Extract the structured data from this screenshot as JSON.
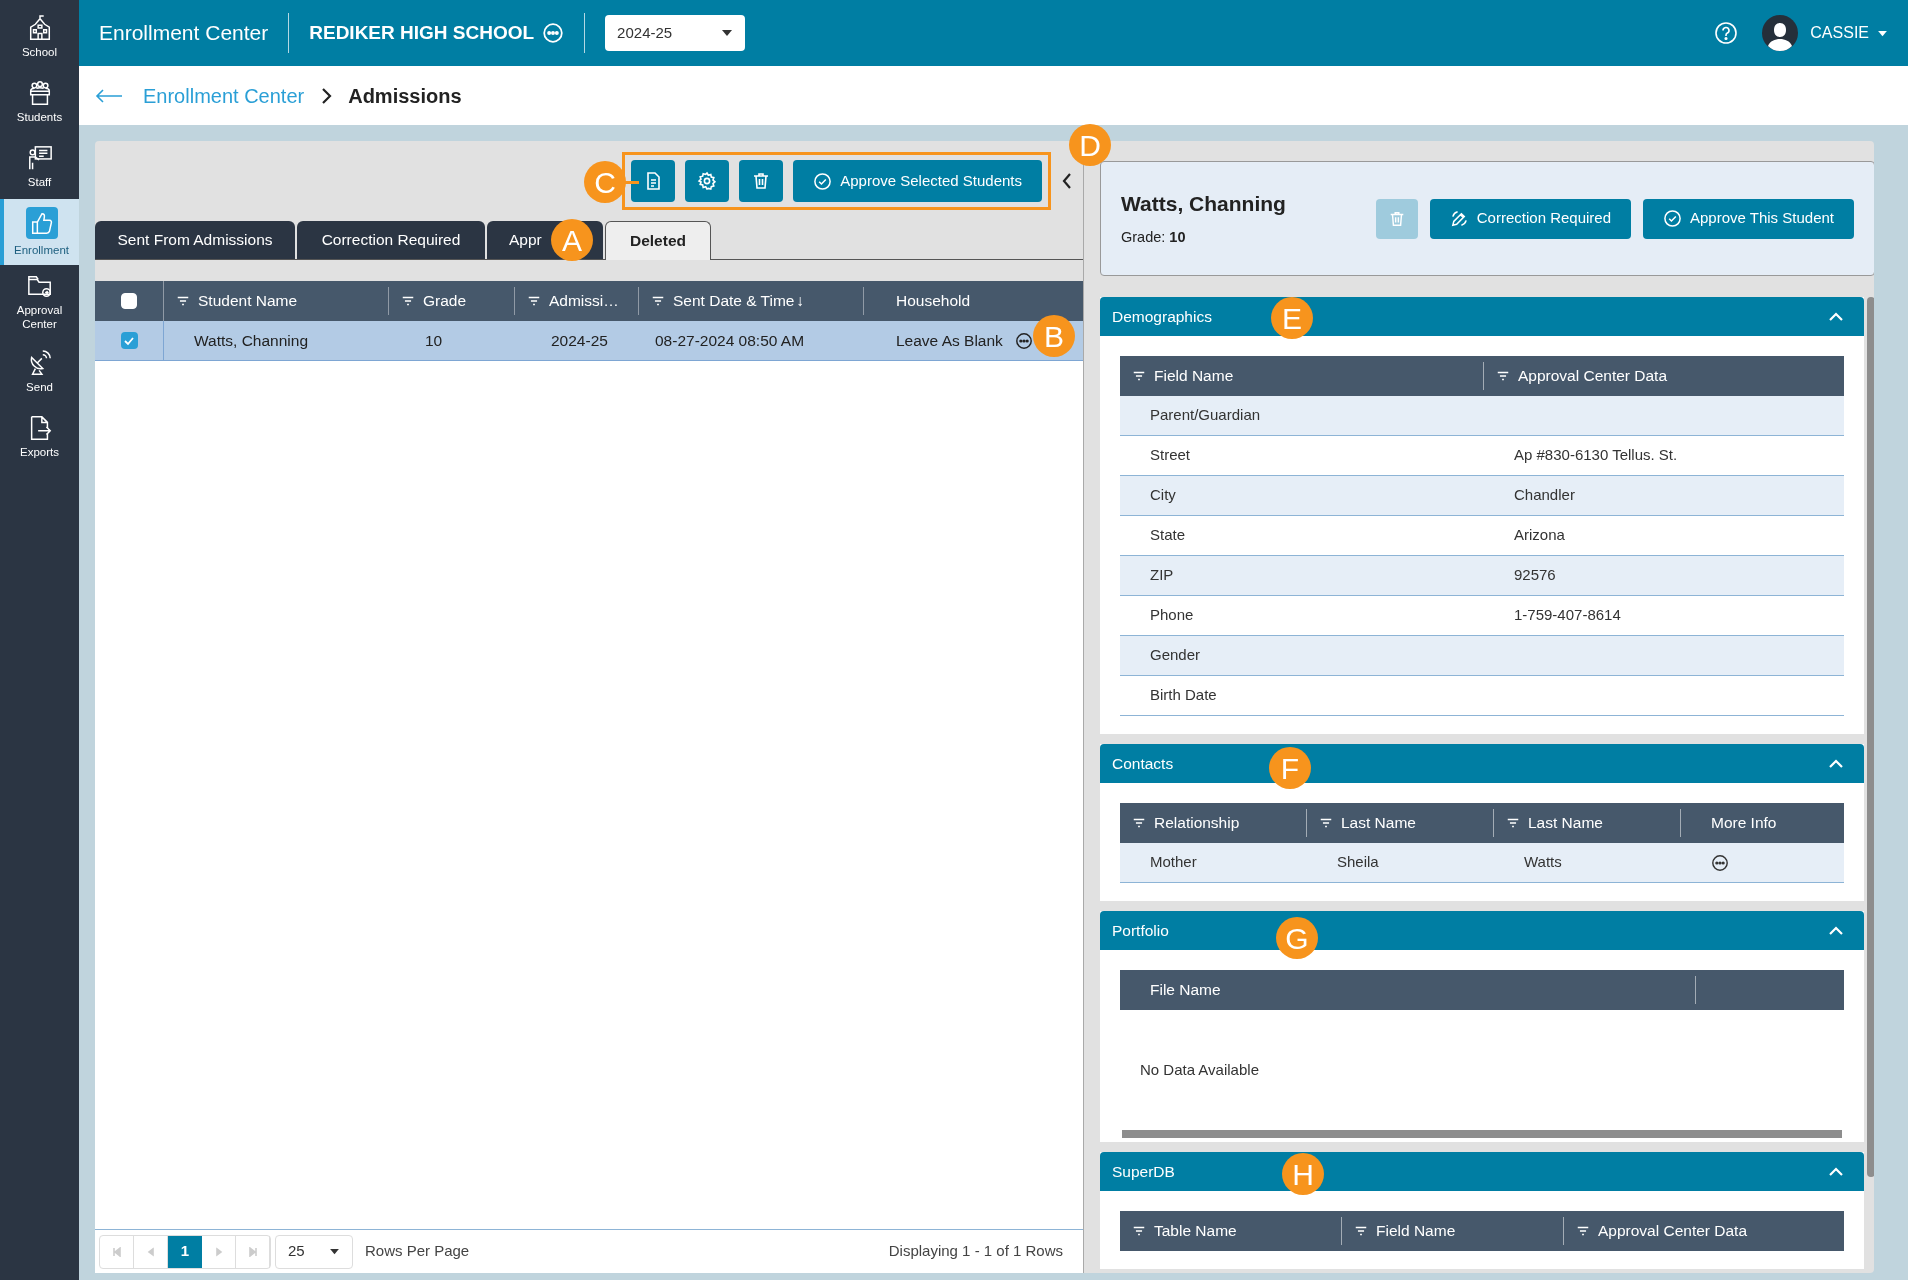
{
  "sidebar": {
    "items": [
      {
        "label": "School",
        "selected": false
      },
      {
        "label": "Students",
        "selected": false
      },
      {
        "label": "Staff",
        "selected": false
      },
      {
        "label": "Enrollment",
        "selected": true
      },
      {
        "label": "Approval Center",
        "selected": false
      },
      {
        "label": "Send",
        "selected": false
      },
      {
        "label": "Exports",
        "selected": false
      }
    ]
  },
  "top_bar": {
    "app_title": "Enrollment Center",
    "school": "REDIKER HIGH SCHOOL",
    "year": "2024-25",
    "user": "CASSIE"
  },
  "breadcrumb": {
    "parent": "Enrollment Center",
    "current": "Admissions"
  },
  "toolbar": {
    "approve_button": "Approve Selected Students"
  },
  "tabs": [
    {
      "label": "Sent From Admissions",
      "selected": false
    },
    {
      "label": "Correction Required",
      "selected": false
    },
    {
      "label": "Appr",
      "selected": false
    },
    {
      "label": "Deleted",
      "selected": true
    }
  ],
  "table": {
    "select_all_checked": false,
    "columns": [
      {
        "label": "Student Name",
        "filter": true
      },
      {
        "label": "Grade",
        "filter": true
      },
      {
        "label": "Admissi…",
        "filter": true
      },
      {
        "label": "Sent Date & Time",
        "filter": true,
        "sort_indicator": "↓"
      },
      {
        "label": "Household",
        "filter": false
      }
    ],
    "rows": [
      {
        "checked": true,
        "selected": true,
        "cells": [
          "Watts, Channing",
          "10",
          "2024-25",
          "08-27-2024 08:50 AM",
          "Leave As Blank"
        ]
      }
    ]
  },
  "pagination": {
    "page": "1",
    "rows_per_page": "25",
    "rows_per_page_label": "Rows Per Page",
    "summary": "Displaying 1 - 1 of 1 Rows"
  },
  "detail": {
    "name": "Watts, Channing",
    "grade_label": "Grade:",
    "grade": "10",
    "delete_disabled": true,
    "correction_button": "Correction Required",
    "approve_button": "Approve This Student"
  },
  "sections": [
    {
      "title": "Demographics",
      "expanded": true,
      "columns": [
        {
          "label": "Field Name",
          "filter": true
        },
        {
          "label": "Approval Center Data",
          "filter": true
        }
      ],
      "rows": [
        [
          "Parent/Guardian",
          ""
        ],
        [
          "Street",
          "Ap #830-6130 Tellus. St."
        ],
        [
          "City",
          "Chandler"
        ],
        [
          "State",
          "Arizona"
        ],
        [
          "ZIP",
          "92576"
        ],
        [
          "Phone",
          "1-759-407-8614"
        ],
        [
          "Gender",
          ""
        ],
        [
          "Birth Date",
          ""
        ]
      ]
    },
    {
      "title": "Contacts",
      "expanded": true,
      "columns": [
        {
          "label": "Relationship",
          "filter": true
        },
        {
          "label": "Last Name",
          "filter": true
        },
        {
          "label": "Last Name",
          "filter": true
        },
        {
          "label": "More Info",
          "filter": false
        }
      ],
      "rows": [
        [
          "Mother",
          "Sheila",
          "Watts"
        ]
      ],
      "row_more_button": true
    },
    {
      "title": "Portfolio",
      "expanded": true,
      "columns": [
        {
          "label": "File Name",
          "filter": false
        }
      ],
      "empty_text": "No Data Available"
    },
    {
      "title": "SuperDB",
      "expanded": true,
      "columns": [
        {
          "label": "Table Name",
          "filter": true
        },
        {
          "label": "Field Name",
          "filter": true
        },
        {
          "label": "Approval Center Data",
          "filter": true
        }
      ]
    }
  ],
  "callouts": [
    {
      "letter": "A"
    },
    {
      "letter": "B"
    },
    {
      "letter": "C"
    },
    {
      "letter": "D"
    },
    {
      "letter": "E"
    },
    {
      "letter": "F"
    },
    {
      "letter": "G"
    },
    {
      "letter": "H"
    }
  ]
}
